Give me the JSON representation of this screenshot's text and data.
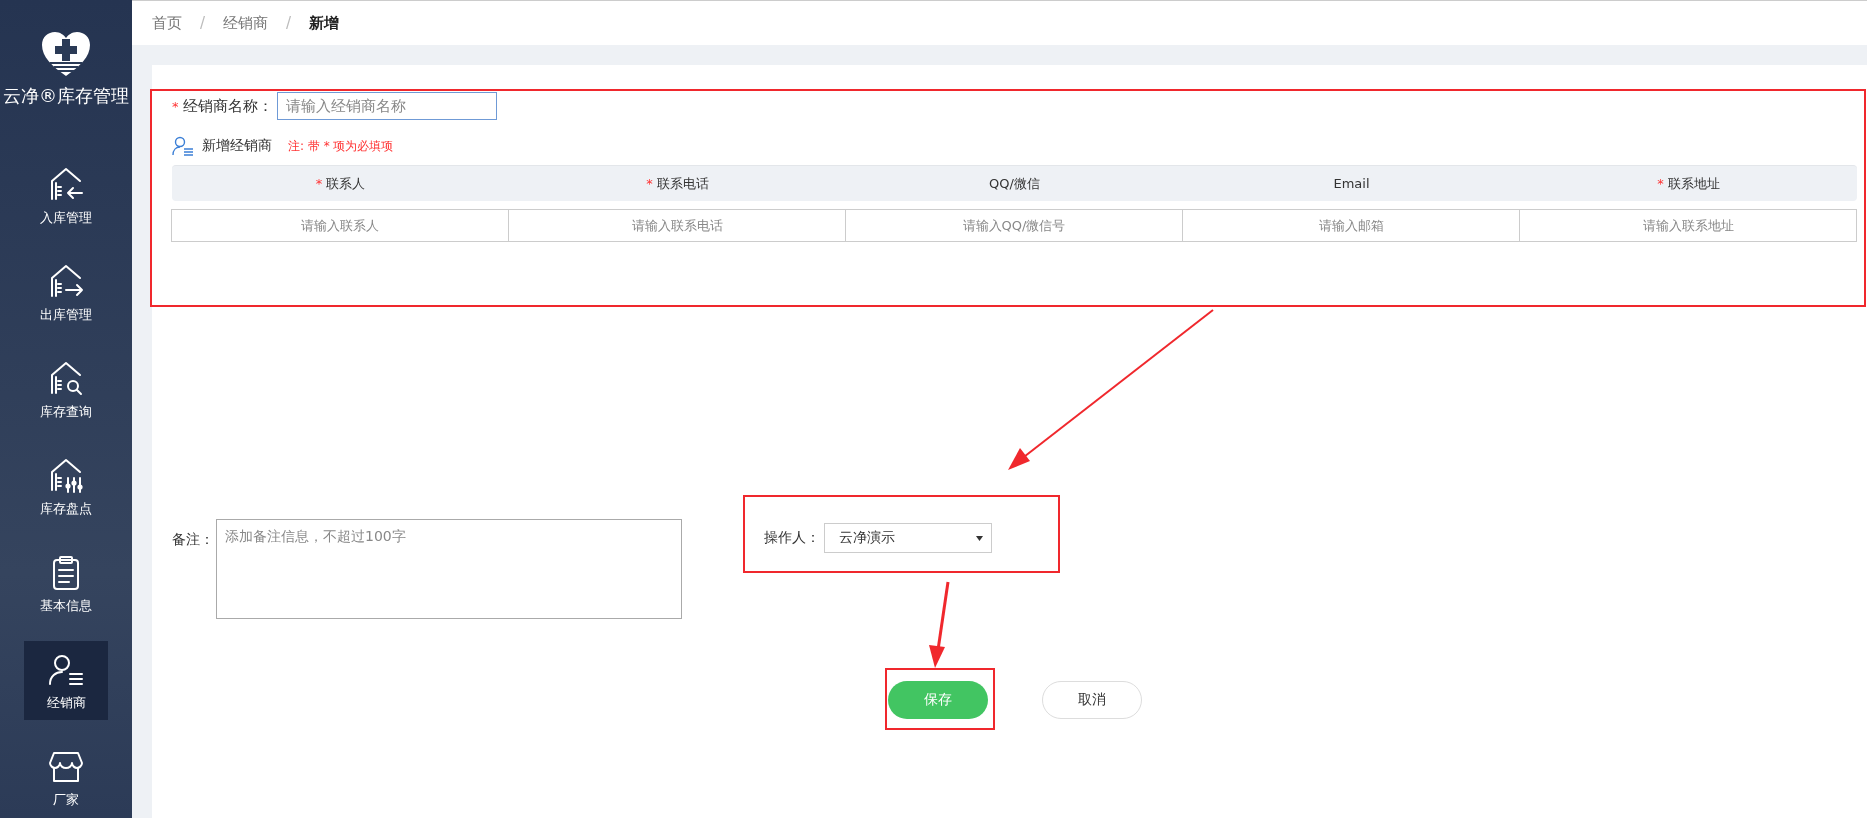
{
  "sidebar": {
    "title": "云净®库存管理",
    "items": [
      {
        "label": "入库管理",
        "selected": false
      },
      {
        "label": "出库管理",
        "selected": false
      },
      {
        "label": "库存查询",
        "selected": false
      },
      {
        "label": "库存盘点",
        "selected": false
      },
      {
        "label": "基本信息",
        "selected": false
      },
      {
        "label": "经销商",
        "selected": true
      },
      {
        "label": "厂家",
        "selected": false
      }
    ]
  },
  "breadcrumb": [
    {
      "label": "首页",
      "current": false
    },
    {
      "label": "经销商",
      "current": false
    },
    {
      "label": "新增",
      "current": true
    }
  ],
  "breadcrumb_separator": "/",
  "name_field": {
    "label": "经销商名称：",
    "required": true,
    "placeholder": "请输入经销商名称"
  },
  "section": {
    "title": "新增经销商",
    "note": "注: 带 * 项为必填项"
  },
  "required_mark": "*",
  "contact_table": {
    "columns": [
      {
        "label": "联系人",
        "required": true,
        "placeholder": "请输入联系人"
      },
      {
        "label": "联系电话",
        "required": true,
        "placeholder": "请输入联系电话"
      },
      {
        "label": "QQ/微信",
        "required": false,
        "placeholder": "请输入QQ/微信号"
      },
      {
        "label": "Email",
        "required": false,
        "placeholder": "请输入邮箱"
      },
      {
        "label": "联系地址",
        "required": true,
        "placeholder": "请输入联系地址"
      }
    ]
  },
  "remark": {
    "label": "备注：",
    "placeholder": "添加备注信息，不超过100字"
  },
  "operator": {
    "label": "操作人：",
    "value": "云净演示"
  },
  "buttons": [
    {
      "label": "保存",
      "kind": "primary"
    },
    {
      "label": "取消",
      "kind": "secondary"
    }
  ]
}
